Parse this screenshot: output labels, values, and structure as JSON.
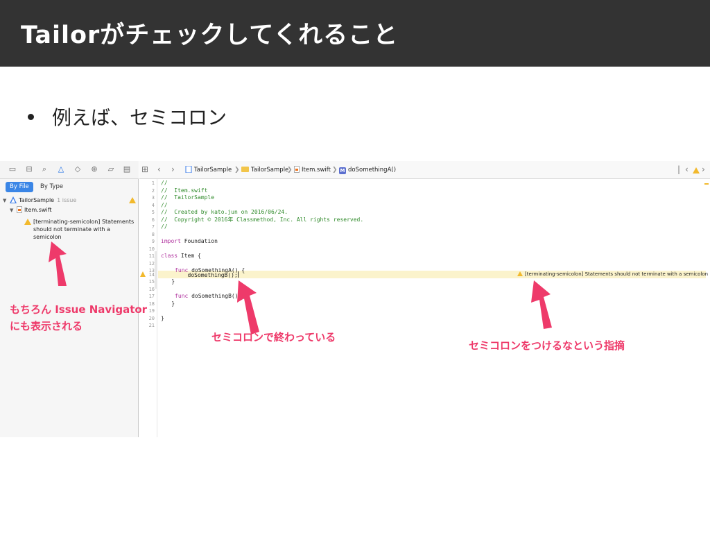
{
  "slide": {
    "title": "Tailorがチェックしてくれること",
    "bullet": "例えば、セミコロン"
  },
  "xcode": {
    "navigator": {
      "tabs": [
        "By File",
        "By Type"
      ],
      "project": "TailorSample",
      "project_issue_count": "1 issue",
      "file": "Item.swift",
      "issue": "[terminating-semicolon] Statements should not terminate with a semicolon"
    },
    "jumpbar": {
      "items": [
        "TailorSample",
        "TailorSample",
        "Item.swift",
        "doSomethingA()"
      ]
    },
    "editor": {
      "line_numbers": [
        "1",
        "2",
        "3",
        "4",
        "5",
        "6",
        "7",
        "8",
        "9",
        "10",
        "11",
        "12",
        "13",
        "14",
        "15",
        "16",
        "17",
        "18",
        "19",
        "20",
        "21"
      ],
      "code": {
        "l1": "//",
        "l2": "//  Item.swift",
        "l3": "//  TailorSample",
        "l4": "//",
        "l5": "//  Created by kato.jun on 2016/06/24.",
        "l6": "//  Copyright © 2016年 Classmethod, Inc. All rights reserved.",
        "l7": "//",
        "l9_kw": "import",
        "l9_rest": " Foundation",
        "l11_kw": "class",
        "l11_rest": " Item {",
        "l13_kw": "func",
        "l13_rest": " doSomethingA() {",
        "l14": "        doSomethingB();",
        "l15": "    }",
        "l17_kw": "func",
        "l17_rest": " doSomethingB() {",
        "l18": "    }",
        "l20": "}"
      },
      "inline_warning": "[terminating-semicolon] Statements should not terminate with a semicolon"
    }
  },
  "annotations": {
    "navigator_note_line1": "もちろん Issue Navigator",
    "navigator_note_line2": "にも表示される",
    "semicolon_note": "セミコロンで終わっている",
    "warning_note": "セミコロンをつけるなという指摘"
  },
  "colors": {
    "header_bg": "#333333",
    "annotation": "#ee3a6a",
    "warning": "#f2b92c",
    "selected_tab": "#3b86e6",
    "comment": "#2f8a2a",
    "keyword": "#b0329e"
  },
  "icons": [
    "folder-icon",
    "source-control-icon",
    "symbol-icon",
    "find-icon",
    "issue-warning-icon",
    "test-icon",
    "debug-icon",
    "breakpoint-icon",
    "report-icon",
    "grid-icon",
    "back-icon",
    "forward-icon"
  ]
}
